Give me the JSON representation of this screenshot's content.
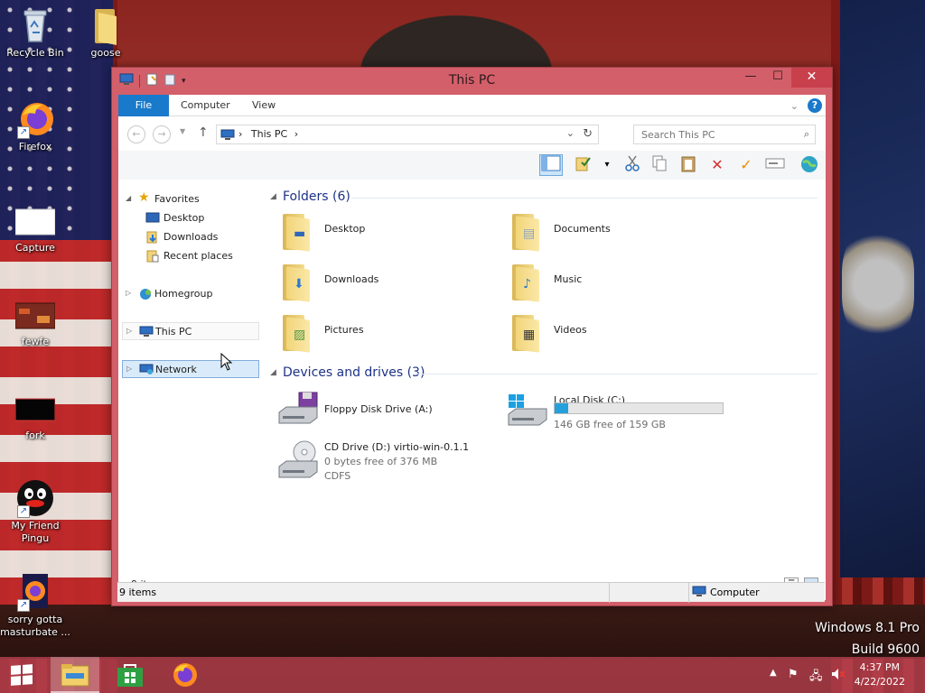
{
  "desktop": {
    "icons": [
      {
        "label": "Recycle Bin",
        "icon": "recycle-bin-icon"
      },
      {
        "label": "goose",
        "icon": "folder-icon"
      },
      {
        "label": "Firefox",
        "icon": "firefox-icon"
      },
      {
        "label": "Capture",
        "icon": "image-file-icon"
      },
      {
        "label": "fewfe",
        "icon": "image-file-icon"
      },
      {
        "label": "fork",
        "icon": "image-file-icon"
      },
      {
        "label": "My Friend Pingu",
        "icon": "pingu-icon"
      },
      {
        "label": "sorry gotta masturbate ...",
        "icon": "firefox-icon"
      }
    ],
    "watermark": {
      "line1": "Windows 8.1 Pro",
      "line2": "Build 9600"
    }
  },
  "window": {
    "title": "This PC",
    "controls": {
      "minimize": "—",
      "maximize": "☐",
      "close": "✕"
    },
    "ribbon_tabs": [
      "File",
      "Computer",
      "View"
    ],
    "address": {
      "crumb": "This PC",
      "separator": "›"
    },
    "search": {
      "placeholder": "Search This PC"
    },
    "nav": {
      "favorites": "Favorites",
      "favorites_items": [
        "Desktop",
        "Downloads",
        "Recent places"
      ],
      "homegroup": "Homegroup",
      "this_pc": "This PC",
      "network": "Network"
    },
    "folders_header": "Folders (6)",
    "folders": [
      {
        "name": "Desktop",
        "icon": "desktop-folder-icon"
      },
      {
        "name": "Documents",
        "icon": "documents-folder-icon"
      },
      {
        "name": "Downloads",
        "icon": "downloads-folder-icon"
      },
      {
        "name": "Music",
        "icon": "music-folder-icon"
      },
      {
        "name": "Pictures",
        "icon": "pictures-folder-icon"
      },
      {
        "name": "Videos",
        "icon": "videos-folder-icon"
      }
    ],
    "drives_header": "Devices and drives (3)",
    "drives": [
      {
        "name": "Floppy Disk Drive (A:)",
        "icon": "floppy-drive-icon"
      },
      {
        "name": "Local Disk (C:)",
        "free": "146 GB free of 159 GB",
        "used_fraction": 0.08,
        "icon": "windows-drive-icon"
      },
      {
        "name": "CD Drive (D:) virtio-win-0.1.1",
        "free": "0 bytes free of 376 MB",
        "fs": "CDFS",
        "icon": "cd-drive-icon"
      }
    ],
    "status_count": "9 items",
    "status_bar_count": "9 items",
    "status_zone": "Computer"
  },
  "taskbar": {
    "apps": [
      {
        "name": "File Explorer",
        "icon": "file-explorer-icon",
        "active": true
      },
      {
        "name": "Store",
        "icon": "store-icon",
        "active": false
      },
      {
        "name": "Firefox",
        "icon": "firefox-icon",
        "active": false
      }
    ],
    "clock": {
      "time": "4:37 PM",
      "date": "4/22/2022"
    }
  },
  "colors": {
    "title_bar": "#d35f6a",
    "file_tab": "#1979ca",
    "capacity_bar": "#26a0da",
    "group_header": "#1e3287",
    "taskbar": "#b24150"
  }
}
